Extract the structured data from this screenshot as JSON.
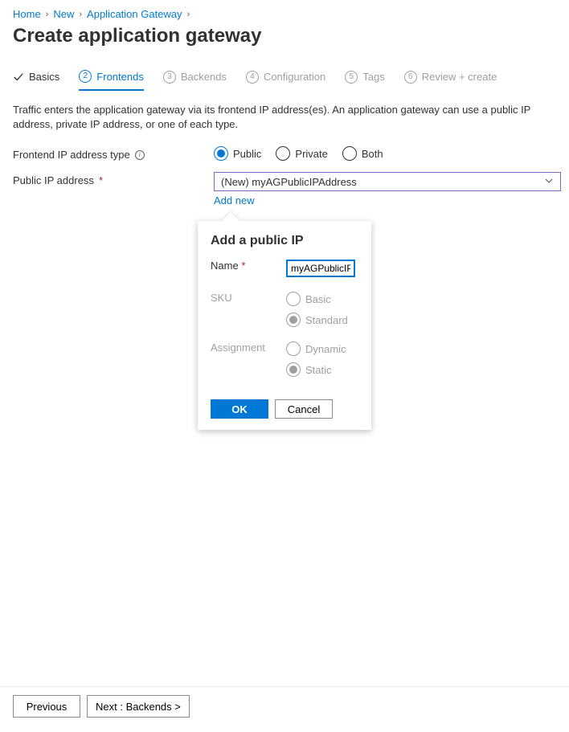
{
  "breadcrumb": {
    "items": [
      "Home",
      "New",
      "Application Gateway"
    ]
  },
  "page_title": "Create application gateway",
  "tabs": [
    {
      "label": "Basics",
      "marker": "check"
    },
    {
      "label": "Frontends",
      "marker": "2"
    },
    {
      "label": "Backends",
      "marker": "3"
    },
    {
      "label": "Configuration",
      "marker": "4"
    },
    {
      "label": "Tags",
      "marker": "5"
    },
    {
      "label": "Review + create",
      "marker": "6"
    }
  ],
  "description": "Traffic enters the application gateway via its frontend IP address(es). An application gateway can use a public IP address, private IP address, or one of each type.",
  "frontend_type": {
    "label": "Frontend IP address type",
    "options": {
      "public": "Public",
      "private": "Private",
      "both": "Both"
    },
    "selected": "public"
  },
  "public_ip": {
    "label": "Public IP address",
    "required_marker": "*",
    "selected_text": "(New) myAGPublicIPAddress",
    "add_new": "Add new"
  },
  "flyout": {
    "title": "Add a public IP",
    "name_label": "Name",
    "name_required": "*",
    "name_value": "myAGPublicIPAddress",
    "sku_label": "SKU",
    "sku_options": {
      "basic": "Basic",
      "standard": "Standard"
    },
    "sku_selected": "standard",
    "assignment_label": "Assignment",
    "assignment_options": {
      "dynamic": "Dynamic",
      "static": "Static"
    },
    "assignment_selected": "static",
    "ok": "OK",
    "cancel": "Cancel"
  },
  "footer": {
    "previous": "Previous",
    "next": "Next : Backends >"
  }
}
